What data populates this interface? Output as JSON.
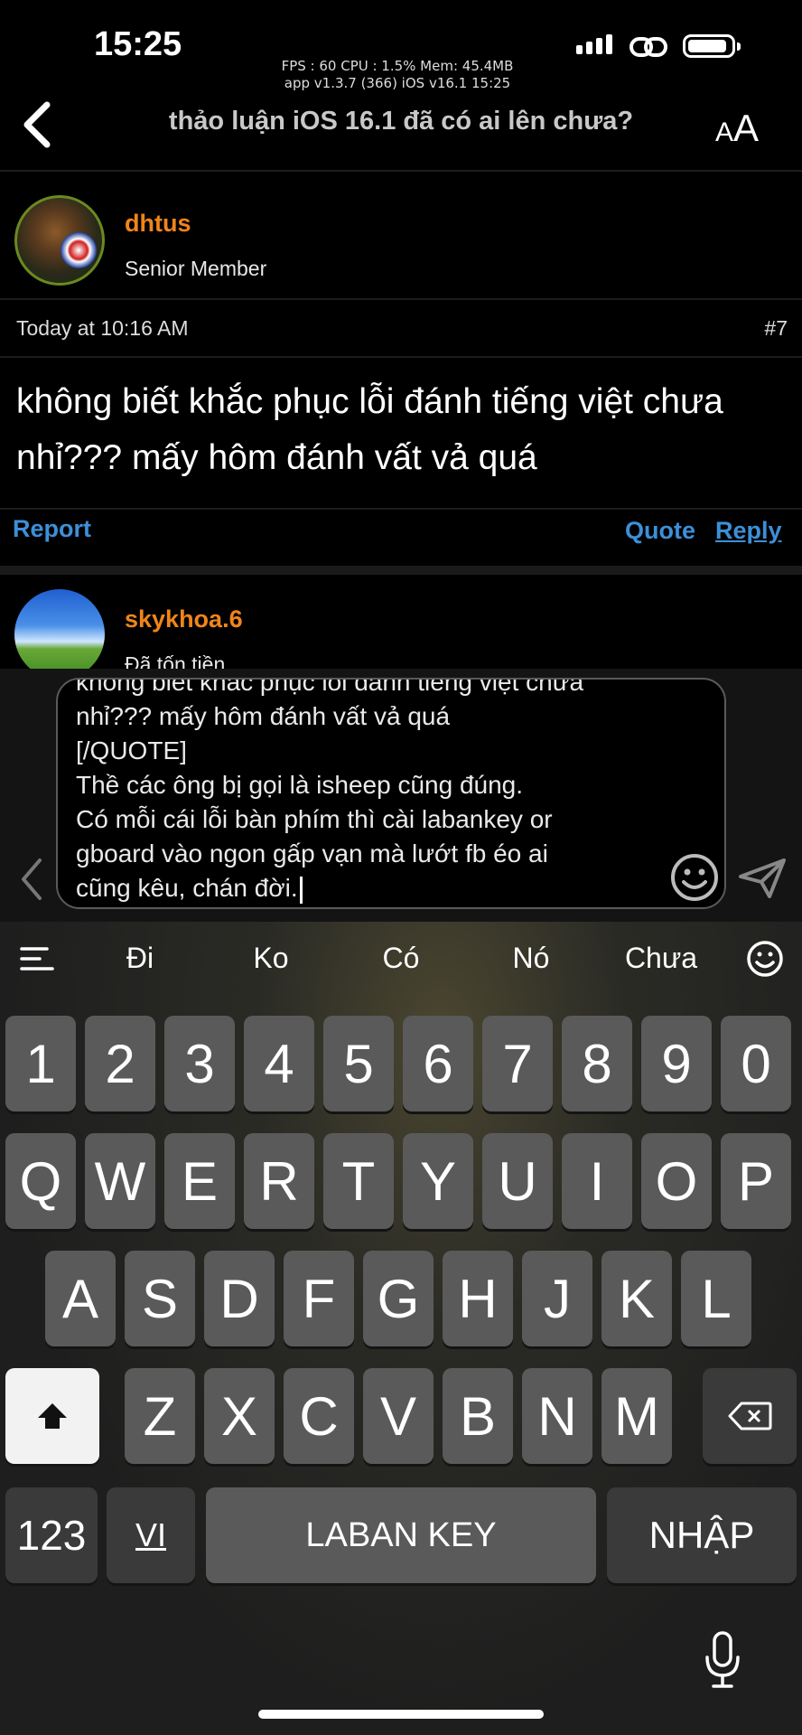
{
  "status_bar": {
    "time": "15:25",
    "debug_line1": "FPS : 60 CPU : 1.5% Mem: 45.4MB",
    "debug_line2": "app v1.3.7 (366) iOS v16.1 15:25"
  },
  "nav": {
    "title": "thảo luận iOS 16.1 đã có ai lên chưa?",
    "font_button_small": "A",
    "font_button_large": "A"
  },
  "posts": [
    {
      "username": "dhtus",
      "role": "Senior Member",
      "timestamp": "Today at 10:16 AM",
      "number": "#7",
      "body": "không biết khắc phục lỗi đánh tiếng việt chưa nhỉ??? mấy hôm đánh vất vả quá",
      "report_label": "Report",
      "quote_label": "Quote",
      "reply_label": "Reply"
    },
    {
      "username": "skykhoa.6",
      "role": "Đã tốn tiền"
    }
  ],
  "compose": {
    "text": "không biết khắc phục lỗi đánh tiếng việt chưa\nnhỉ??? mấy hôm đánh vất vả quá\n[/QUOTE]\nThề các ông bị gọi là isheep cũng đúng.\nCó mỗi cái lỗi bàn phím thì cài labankey or\ngboard vào ngon gấp vạn mà lướt fb éo ai\ncũng kêu, chán đời."
  },
  "keyboard": {
    "suggestions": [
      "Đi",
      "Ko",
      "Có",
      "Nó",
      "Chưa"
    ],
    "number_row": [
      "1",
      "2",
      "3",
      "4",
      "5",
      "6",
      "7",
      "8",
      "9",
      "0"
    ],
    "row1": [
      "Q",
      "W",
      "E",
      "R",
      "T",
      "Y",
      "U",
      "I",
      "O",
      "P"
    ],
    "row2": [
      "A",
      "S",
      "D",
      "F",
      "G",
      "H",
      "J",
      "K",
      "L"
    ],
    "row3": [
      "Z",
      "X",
      "C",
      "V",
      "B",
      "N",
      "M"
    ],
    "mode_label": "123",
    "lang_label": "VI",
    "space_label": "LABAN KEY",
    "enter_label": "NHẬP"
  },
  "colors": {
    "username": "#f0851a",
    "link": "#3d8fd8",
    "background": "#000000"
  }
}
